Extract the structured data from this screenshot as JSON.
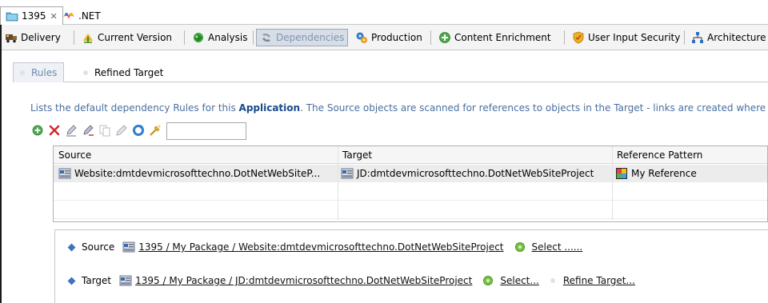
{
  "colors": {
    "active_tab_text": "#7e95b0",
    "description_text": "#4a6fa0",
    "application_bold": "#1a4a8a",
    "selected_row": "#ececec",
    "diamond": "#3d74c2",
    "select_dot": "#7bc043"
  },
  "editor_tabs": [
    {
      "label": "1395",
      "icon": "folder-icon",
      "closable": true,
      "active": true
    },
    {
      "label": ".NET",
      "icon": "dotnet-icon",
      "closable": false,
      "active": false
    }
  ],
  "main_tabs": [
    {
      "label": "Delivery",
      "icon": "delivery-truck-icon"
    },
    {
      "label": "Current Version",
      "icon": "current-version-icon"
    },
    {
      "label": "Analysis",
      "icon": "analysis-icon"
    },
    {
      "label": "Dependencies",
      "icon": "dependencies-icon",
      "active": true
    },
    {
      "label": "Production",
      "icon": "production-icon"
    },
    {
      "label": "Content Enrichment",
      "icon": "content-enrichment-icon"
    },
    {
      "label": "User Input Security",
      "icon": "security-shield-icon"
    },
    {
      "label": "Architecture",
      "icon": "architecture-icon"
    }
  ],
  "sub_tabs": [
    {
      "label": "Rules",
      "active": true
    },
    {
      "label": "Refined Target",
      "active": false
    }
  ],
  "description": {
    "before": "Lists the default dependency Rules for this ",
    "bold": "Application",
    "after": ". The Source objects are scanned for references to objects in the Target - links are created where"
  },
  "toolbar": {
    "buttons": [
      "add-icon",
      "delete-icon",
      "edit-icon",
      "edit-all-icon",
      "copy-icon",
      "pencil-icon",
      "refresh-icon",
      "filter-icon"
    ],
    "filter_value": ""
  },
  "table": {
    "columns": [
      "Source",
      "Target",
      "Reference Pattern"
    ],
    "rows": [
      {
        "source": "Website:dmtdevmicrosofttechno.DotNetWebSiteP...",
        "target": "JD:dmtdevmicrosofttechno.DotNetWebSiteProject",
        "pattern": "My Reference",
        "selected": true
      }
    ]
  },
  "detail": {
    "source_label": "Source",
    "source_path": "1395 / My Package / Website:dmtdevmicrosofttechno.DotNetWebSiteProject",
    "source_select": "Select ......",
    "target_label": "Target",
    "target_path": "1395 / My Package / JD:dmtdevmicrosofttechno.DotNetWebSiteProject",
    "target_select": "Select...",
    "refine_target": "Refine Target..."
  }
}
